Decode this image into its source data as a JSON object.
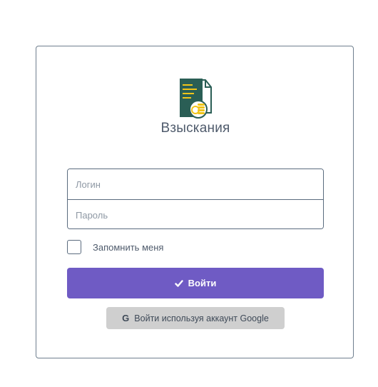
{
  "app": {
    "title": "Взыскания",
    "logo_icon": "document-coins-icon"
  },
  "form": {
    "login_placeholder": "Логин",
    "password_placeholder": "Пароль",
    "remember_label": "Запомнить меня",
    "remember_checked": false,
    "submit_label": "Войти",
    "submit_icon": "check-icon",
    "google_label": "Войти используя аккаунт Google",
    "google_icon": "google-g-icon"
  },
  "colors": {
    "primary": "#6f5bc4",
    "logo_green": "#2a5e55",
    "logo_gold": "#f0c419",
    "google_button": "#cfcfcf",
    "border": "#5a6b7e"
  }
}
